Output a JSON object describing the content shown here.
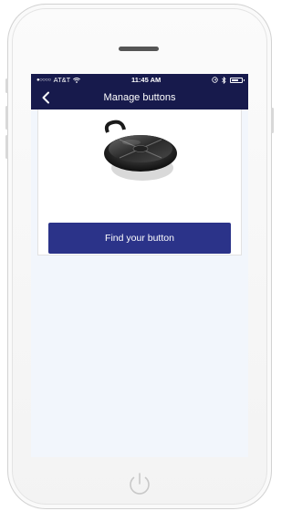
{
  "status_bar": {
    "signal": "●○○○○",
    "carrier": "AT&T",
    "time": "11:45 AM"
  },
  "nav": {
    "title": "Manage buttons"
  },
  "main": {
    "find_button_label": "Find your button"
  },
  "colors": {
    "navbar": "#171a4c",
    "primary_button": "#2b3389",
    "screen_bg": "#f2f6fc"
  },
  "icons": [
    "wifi-icon",
    "location-icon",
    "bluetooth-icon",
    "battery-icon",
    "back-chevron-icon",
    "power-icon"
  ]
}
